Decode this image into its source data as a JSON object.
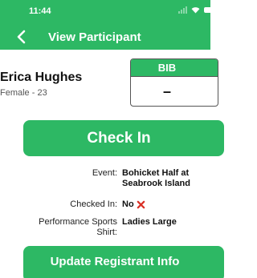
{
  "status": {
    "time": "11:44"
  },
  "nav": {
    "title": "View Participant"
  },
  "participant": {
    "name": "Erica Hughes",
    "gender_age": "Female - 23"
  },
  "bib": {
    "label": "BIB",
    "number": "–"
  },
  "actions": {
    "check_in_label": "Check In",
    "update_label": "Update Registrant Info"
  },
  "details": {
    "event_label": "Event:",
    "event_value_line1": "Bohicket Half at",
    "event_value_line2": "Seabrook Island",
    "checked_in_label": "Checked In:",
    "checked_in_value": "No",
    "shirt_label_line1": "Performance Sports",
    "shirt_label_line2": "Shirt:",
    "shirt_value": "Ladies Large"
  },
  "colors": {
    "brand": "#2db864",
    "negative": "#d93025"
  },
  "icons": {
    "back": "chevron-left-icon",
    "not_checked": "x-mark-icon"
  }
}
